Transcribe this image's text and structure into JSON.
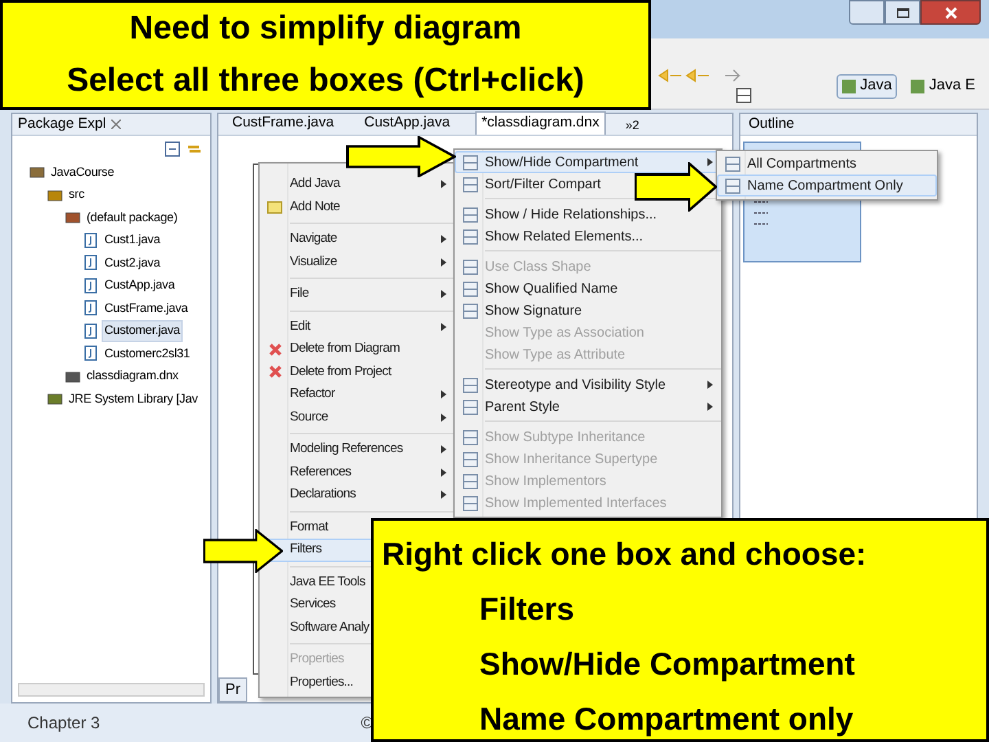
{
  "callout_top": {
    "lines": [
      "Need to simplify diagram",
      "Select all three boxes (Ctrl+click)"
    ]
  },
  "callout_bottom": {
    "heading": "Right click one box and choose:",
    "steps": [
      "Filters",
      "Show/Hide Compartment",
      "Name Compartment only"
    ]
  },
  "toolbar": {
    "perspectives": [
      {
        "label": "Java",
        "selected": true
      },
      {
        "label": "Java E",
        "selected": false
      }
    ]
  },
  "package_explorer": {
    "title": "Package Expl",
    "tree": [
      {
        "label": "JavaCourse",
        "kind": "project",
        "selected": false,
        "children": [
          {
            "label": "src",
            "kind": "folder",
            "selected": false,
            "children": [
              {
                "label": "(default package)",
                "kind": "package",
                "selected": false,
                "children": [
                  {
                    "label": "Cust1.java",
                    "kind": "java",
                    "selected": false
                  },
                  {
                    "label": "Cust2.java",
                    "kind": "java",
                    "selected": false
                  },
                  {
                    "label": "CustApp.java",
                    "kind": "java",
                    "selected": false
                  },
                  {
                    "label": "CustFrame.java",
                    "kind": "java",
                    "selected": false
                  },
                  {
                    "label": "Customer.java",
                    "kind": "java",
                    "selected": true
                  },
                  {
                    "label": "Customerc2sl31",
                    "kind": "java",
                    "selected": false
                  }
                ]
              },
              {
                "label": "classdiagram.dnx",
                "kind": "diagram",
                "selected": false
              }
            ]
          },
          {
            "label": "JRE System Library [Jav",
            "kind": "library",
            "selected": false
          }
        ]
      }
    ]
  },
  "editor": {
    "tabs": [
      {
        "label": "CustFrame.java",
        "selected": false
      },
      {
        "label": "CustApp.java",
        "selected": false
      },
      {
        "label": "*classdiagram.dnx",
        "selected": true
      }
    ],
    "overflow": "»2",
    "bottom_tab": "Pr"
  },
  "outline": {
    "title": "Outline"
  },
  "context_menu": {
    "groups": [
      [
        {
          "label": "Add Java",
          "kind": "plain",
          "submenu": true,
          "selected": false,
          "disabled": false
        },
        {
          "label": "Add Note",
          "kind": "note",
          "submenu": false,
          "selected": false,
          "disabled": false
        }
      ],
      [
        {
          "label": "Navigate",
          "kind": "plain",
          "submenu": true,
          "selected": false,
          "disabled": false
        },
        {
          "label": "Visualize",
          "kind": "plain",
          "submenu": true,
          "selected": false,
          "disabled": false
        }
      ],
      [
        {
          "label": "File",
          "kind": "plain",
          "submenu": true,
          "selected": false,
          "disabled": false
        }
      ],
      [
        {
          "label": "Edit",
          "kind": "plain",
          "submenu": true,
          "selected": false,
          "disabled": false
        },
        {
          "label": "Delete from Diagram",
          "kind": "delete",
          "submenu": false,
          "selected": false,
          "disabled": false
        },
        {
          "label": "Delete from Project",
          "kind": "delete",
          "submenu": false,
          "selected": false,
          "disabled": false
        },
        {
          "label": "Refactor",
          "kind": "plain",
          "submenu": true,
          "selected": false,
          "disabled": false
        },
        {
          "label": "Source",
          "kind": "plain",
          "submenu": true,
          "selected": false,
          "disabled": false
        }
      ],
      [
        {
          "label": "Modeling References",
          "kind": "plain",
          "submenu": true,
          "selected": false,
          "disabled": false
        },
        {
          "label": "References",
          "kind": "plain",
          "submenu": true,
          "selected": false,
          "disabled": false
        },
        {
          "label": "Declarations",
          "kind": "plain",
          "submenu": true,
          "selected": false,
          "disabled": false
        }
      ],
      [
        {
          "label": "Format",
          "kind": "plain",
          "selected": false,
          "disabled": false
        },
        {
          "label": "Filters",
          "kind": "plain",
          "selected": true,
          "disabled": false
        }
      ],
      [
        {
          "label": "Java EE Tools",
          "kind": "plain",
          "selected": false,
          "disabled": false
        },
        {
          "label": "Services",
          "kind": "plain",
          "selected": false,
          "disabled": false
        },
        {
          "label": "Software Analy",
          "kind": "plain",
          "selected": false,
          "disabled": false
        }
      ],
      [
        {
          "label": "Properties",
          "kind": "plain",
          "selected": false,
          "disabled": true
        },
        {
          "label": "Properties...",
          "kind": "plain",
          "selected": false,
          "disabled": false
        }
      ]
    ]
  },
  "submenu": {
    "groups": [
      [
        {
          "label": "Show/Hide Compartment",
          "kind": "icon",
          "submenu": true,
          "selected": true,
          "disabled": false
        },
        {
          "label": "Sort/Filter Compart",
          "kind": "icon",
          "selected": false,
          "disabled": false
        }
      ],
      [
        {
          "label": "Show / Hide Relationships...",
          "kind": "icon",
          "submenu": false,
          "selected": false,
          "disabled": false
        },
        {
          "label": "Show Related Elements...",
          "kind": "icon",
          "submenu": false,
          "selected": false,
          "disabled": false
        }
      ],
      [
        {
          "label": "Use Class Shape",
          "kind": "icon",
          "submenu": false,
          "selected": false,
          "disabled": true
        },
        {
          "label": "Show Qualified Name",
          "kind": "icon",
          "submenu": false,
          "selected": false,
          "disabled": false
        },
        {
          "label": "Show Signature",
          "kind": "icon",
          "submenu": false,
          "selected": false,
          "disabled": false
        },
        {
          "label": "Show Type as Association",
          "kind": "plain",
          "submenu": false,
          "selected": false,
          "disabled": true
        },
        {
          "label": "Show Type as Attribute",
          "kind": "plain",
          "submenu": false,
          "selected": false,
          "disabled": true
        }
      ],
      [
        {
          "label": "Stereotype and Visibility Style",
          "kind": "icon",
          "submenu": true,
          "selected": false,
          "disabled": false
        },
        {
          "label": "Parent Style",
          "kind": "icon",
          "submenu": true,
          "selected": false,
          "disabled": false
        }
      ],
      [
        {
          "label": "Show Subtype Inheritance",
          "kind": "icon",
          "submenu": false,
          "selected": false,
          "disabled": true
        },
        {
          "label": "Show Inheritance Supertype",
          "kind": "icon",
          "submenu": false,
          "selected": false,
          "disabled": true
        },
        {
          "label": "Show Implementors",
          "kind": "icon",
          "submenu": false,
          "selected": false,
          "disabled": true
        },
        {
          "label": "Show Implemented Interfaces",
          "kind": "icon",
          "submenu": false,
          "selected": false,
          "disabled": true
        }
      ]
    ]
  },
  "compartment_menu": {
    "groups": [
      [
        {
          "label": "All Compartments",
          "kind": "icon",
          "submenu": false,
          "selected": false,
          "disabled": false
        },
        {
          "label": "Name Compartment Only",
          "kind": "icon",
          "submenu": false,
          "selected": true,
          "disabled": false
        }
      ]
    ]
  },
  "footer": {
    "chapter": "Chapter 3",
    "copyright": "©"
  }
}
